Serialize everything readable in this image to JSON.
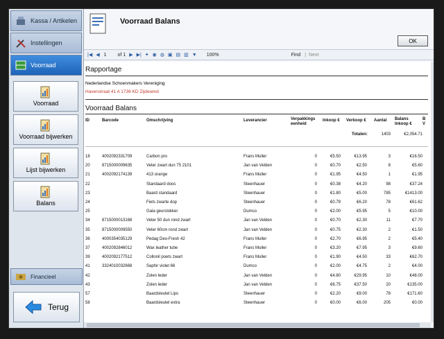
{
  "sidebar": {
    "tabs": [
      {
        "label": "Kassa / Artikelen",
        "icon": "cash-register-icon"
      },
      {
        "label": "Instellingen",
        "icon": "tools-icon"
      },
      {
        "label": "Voorraad",
        "icon": "stock-icon"
      }
    ],
    "buttons": [
      {
        "label": "Voorraad",
        "icon": "chart-clipboard-icon"
      },
      {
        "label": "Voorraad bijwerken",
        "icon": "chart-clipboard-icon"
      },
      {
        "label": "Lijst bijwerken",
        "icon": "chart-clipboard-icon"
      },
      {
        "label": "Balans",
        "icon": "chart-clipboard-icon"
      }
    ],
    "financial_label": "Financieel",
    "back_label": "Terug"
  },
  "header": {
    "title": "Voorraad Balans",
    "ok_label": "OK"
  },
  "toolbar": {
    "page": "1",
    "of": "of 1",
    "zoom": "100%",
    "find": "Find",
    "separator": "|",
    "next": "Next"
  },
  "report": {
    "section1": "Rapportage",
    "company": "Nederlandse Schoenmakers Vereniging",
    "address": "Havenstraat 41 A 1736 KD Zijdewind",
    "section2": "Voorraad Balans",
    "columns": [
      "ID",
      "Barcode",
      "Omschrijving",
      "Leverancier",
      "Verpakkings eenheid",
      "Inkoop €",
      "Verkoop €",
      "Aantal",
      "Balans Inkoop €",
      "B V"
    ],
    "totals_label": "Totalen:",
    "totals_aantal": "1403",
    "totals_balans": "€2,054.71",
    "rows": [
      {
        "id": "18",
        "barcode": "4002092331709",
        "desc": "Carbon pro",
        "supplier": "Frans Muller",
        "unit": "0",
        "buy": "€5.50",
        "sell": "€13.95",
        "qty": "3",
        "bal": "€16.50"
      },
      {
        "id": "20",
        "barcode": "8715000009635",
        "desc": "Veter zwart dun 75 2101",
        "supplier": "Jan van Velden",
        "unit": "0",
        "buy": "€0.70",
        "sell": "€2.50",
        "qty": "8",
        "bal": "€5.60"
      },
      {
        "id": "21",
        "barcode": "4002092174139",
        "desc": "413 orange",
        "supplier": "Frans Muller",
        "unit": "0",
        "buy": "€1.95",
        "sell": "€4.50",
        "qty": "1",
        "bal": "€1.95"
      },
      {
        "id": "22",
        "barcode": "",
        "desc": "Standaard doos",
        "supplier": "Steenhauer",
        "unit": "0",
        "buy": "€0.38",
        "sell": "€4.20",
        "qty": "98",
        "bal": "€37.24"
      },
      {
        "id": "23",
        "barcode": "",
        "desc": "Baard standaard",
        "supplier": "Steenhauer",
        "unit": "0",
        "buy": "€1.80",
        "sell": "€5.00",
        "qty": "785",
        "bal": "€1413.00"
      },
      {
        "id": "24",
        "barcode": "",
        "desc": "Fiets zwarte dop",
        "supplier": "Steenhauer",
        "unit": "0",
        "buy": "€0.79",
        "sell": "€6.20",
        "qty": "78",
        "bal": "€61.62"
      },
      {
        "id": "25",
        "barcode": "",
        "desc": "Gala geurslokker",
        "supplier": "Dumco",
        "unit": "0",
        "buy": "€2.00",
        "sell": "€5.95",
        "qty": "5",
        "bal": "€10.00"
      },
      {
        "id": "34",
        "barcode": "8715000013168",
        "desc": "Veter 50 dun rond zwart",
        "supplier": "Jan van Velden",
        "unit": "0",
        "buy": "€0.70",
        "sell": "€2.30",
        "qty": "11",
        "bal": "€7.70"
      },
      {
        "id": "35",
        "barcode": "8715000009550",
        "desc": "Veter 60cm rond zwart",
        "supplier": "Jan van Velden",
        "unit": "0",
        "buy": "€0.75",
        "sell": "€2.30",
        "qty": "2",
        "bal": "€1.50"
      },
      {
        "id": "36",
        "barcode": "4000354035129",
        "desc": "Pedag Deo-Fresh 42",
        "supplier": "Frans Muller",
        "unit": "0",
        "buy": "€2.70",
        "sell": "€6.95",
        "qty": "2",
        "bal": "€5.40"
      },
      {
        "id": "37",
        "barcode": "4002092846012",
        "desc": "Wax leather tube",
        "supplier": "Frans Muller",
        "unit": "0",
        "buy": "€3.20",
        "sell": "€7.95",
        "qty": "3",
        "bal": "€9.60"
      },
      {
        "id": "39",
        "barcode": "4002092177512",
        "desc": "Collonil poets zwart",
        "supplier": "Frans Muller",
        "unit": "0",
        "buy": "€1.90",
        "sell": "€4.50",
        "qty": "33",
        "bal": "€62.70"
      },
      {
        "id": "41",
        "barcode": "3324010032668",
        "desc": "Saphir violet 66",
        "supplier": "Dumco",
        "unit": "0",
        "buy": "€2.00",
        "sell": "€4.75",
        "qty": "2",
        "bal": "€4.00"
      },
      {
        "id": "42",
        "barcode": "",
        "desc": "Zolen leder",
        "supplier": "Jan van Velden",
        "unit": "0",
        "buy": "€4.80",
        "sell": "€29.95",
        "qty": "10",
        "bal": "€48.00"
      },
      {
        "id": "43",
        "barcode": "",
        "desc": "Zolen leder",
        "supplier": "Jan van Velden",
        "unit": "0",
        "buy": "€6.75",
        "sell": "€37.50",
        "qty": "20",
        "bal": "€135.00"
      },
      {
        "id": "57",
        "barcode": "",
        "desc": "Baardsleutel Lips",
        "supplier": "Steenhauer",
        "unit": "0",
        "buy": "€2.20",
        "sell": "€9.00",
        "qty": "78",
        "bal": "€171.60"
      },
      {
        "id": "58",
        "barcode": "",
        "desc": "Baardsleutel extra",
        "supplier": "Steenhauer",
        "unit": "0",
        "buy": "€0.00",
        "sell": "€6.00",
        "qty": "205",
        "bal": "€0.00"
      }
    ]
  }
}
